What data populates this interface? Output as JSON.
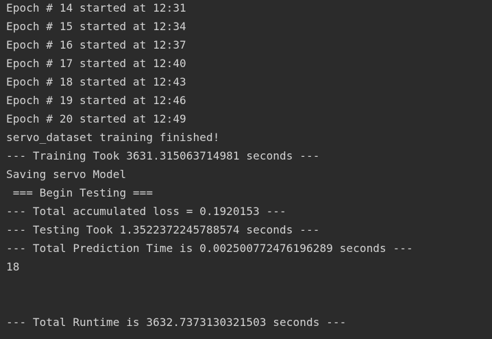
{
  "console": {
    "lines": [
      "Epoch # 14 started at 12:31",
      "Epoch # 15 started at 12:34",
      "Epoch # 16 started at 12:37",
      "Epoch # 17 started at 12:40",
      "Epoch # 18 started at 12:43",
      "Epoch # 19 started at 12:46",
      "Epoch # 20 started at 12:49",
      "servo_dataset training finished!",
      "--- Training Took 3631.315063714981 seconds ---",
      "Saving servo Model",
      " === Begin Testing ===",
      "--- Total accumulated loss = 0.1920153 ---",
      "--- Testing Took 1.3522372245788574 seconds ---",
      "--- Total Prediction Time is 0.002500772476196289 seconds ---",
      "18",
      "",
      "",
      "--- Total Runtime is 3632.7373130321503 seconds ---"
    ]
  }
}
